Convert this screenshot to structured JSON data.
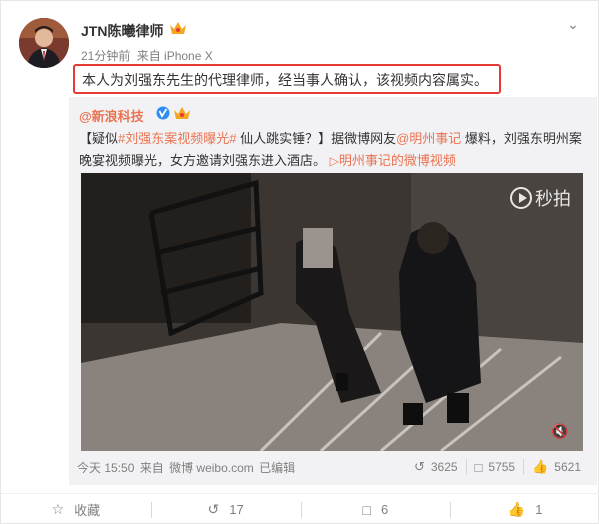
{
  "post": {
    "user_name": "JTN陈曦律师",
    "time": "21分钟前",
    "source": "来自 iPhone X",
    "text": "本人为刘强东先生的代理律师，经当事人确认，该视频内容属实。"
  },
  "repost": {
    "user": "@新浪科技",
    "text_prefix": "【疑似",
    "hashtag1": "#刘强东案视频曝光#",
    "text_mid1": " 仙人跳实锤？】据微博网友",
    "mention": "@明州事记",
    "text_mid2": " 爆料，刘强东明州案晚宴视频曝光，女方邀请刘强东进入酒店。",
    "video_link": "明州事记的微博视频",
    "video_watermark": "秒拍",
    "time": "今天 15:50",
    "source_prefix": "来自",
    "source": "微博 weibo.com",
    "edited": "已编辑",
    "reposts": "3625",
    "comments": "5755",
    "likes": "5621"
  },
  "actions": {
    "favorite": "收藏",
    "repost": "17",
    "comment": "6",
    "like": "1"
  },
  "colors": {
    "accent": "#eb7350",
    "highlight_box": "#e53935",
    "muted": "#808080"
  }
}
